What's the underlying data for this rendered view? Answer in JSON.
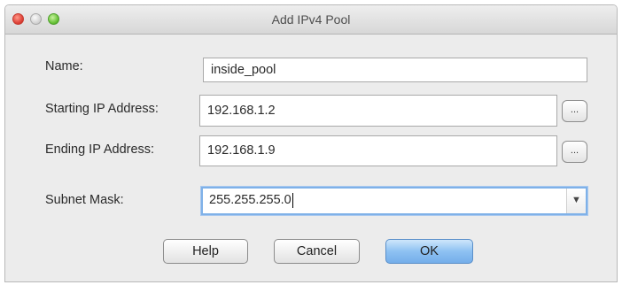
{
  "window": {
    "title": "Add IPv4 Pool"
  },
  "form": {
    "name_label": "Name:",
    "name_value": "inside_pool",
    "start_label": "Starting IP Address:",
    "start_value": "192.168.1.2",
    "start_button": "...",
    "end_label": "Ending IP Address:",
    "end_value": "192.168.1.9",
    "end_button": "...",
    "mask_label": "Subnet Mask:",
    "mask_value": "255.255.255.0"
  },
  "buttons": {
    "help": "Help",
    "cancel": "Cancel",
    "ok": "OK"
  }
}
